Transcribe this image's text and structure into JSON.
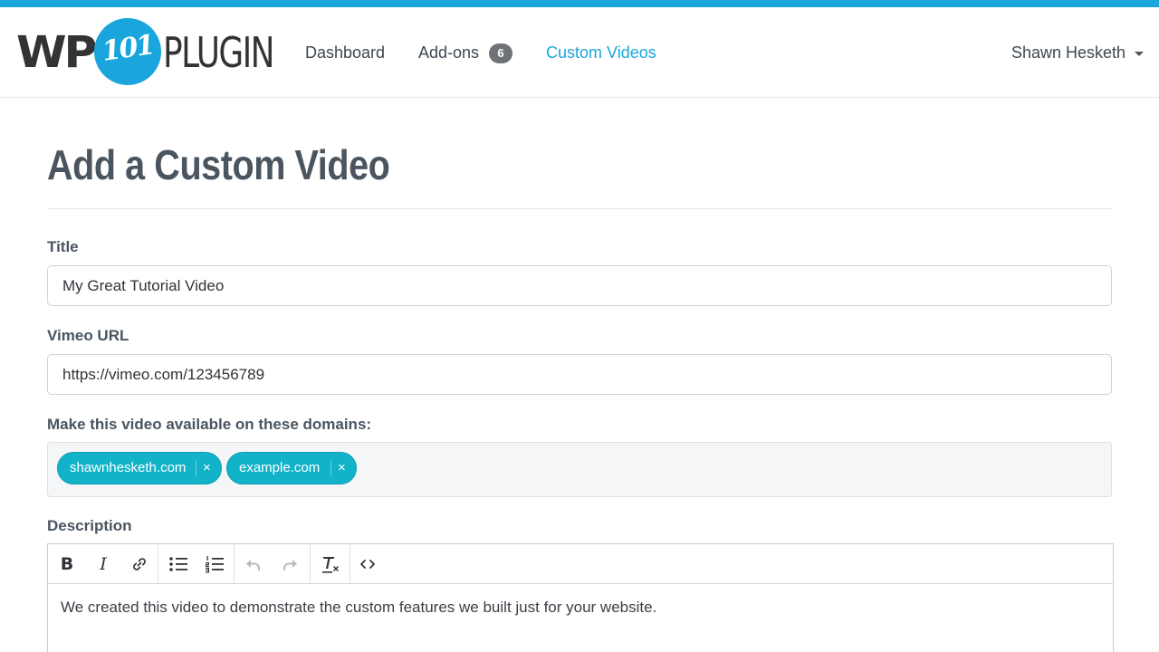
{
  "brand": {
    "wp": "WP",
    "num": "101",
    "plugin": "PLUGIN",
    "accent": "#1aa6dc"
  },
  "nav": {
    "dashboard": "Dashboard",
    "addons": "Add-ons",
    "addons_count": "6",
    "custom_videos": "Custom Videos",
    "user": "Shawn Hesketh"
  },
  "page": {
    "title": "Add a Custom Video"
  },
  "form": {
    "title_label": "Title",
    "title_value": "My Great Tutorial Video",
    "vimeo_label": "Vimeo URL",
    "vimeo_value": "https://vimeo.com/123456789",
    "domains_label": "Make this video available on these domains:",
    "domains": [
      {
        "text": "shawnhesketh.com",
        "remove": "×"
      },
      {
        "text": "example.com",
        "remove": "×"
      }
    ],
    "description_label": "Description",
    "description_value": "We created this video to demonstrate the custom features we built just for your website."
  },
  "editor_toolbar": {
    "bold": "B",
    "italic": "I",
    "icons": [
      "bold-icon",
      "italic-icon",
      "link-icon",
      "bullet-list-icon",
      "numbered-list-icon",
      "undo-icon",
      "redo-icon",
      "clear-format-icon",
      "source-code-icon"
    ]
  }
}
